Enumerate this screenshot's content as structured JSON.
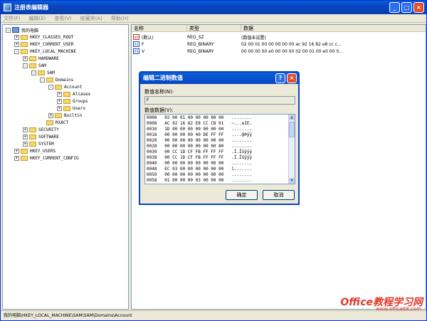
{
  "window": {
    "title": "注册表编辑器",
    "min": "_",
    "max": "□",
    "close": "×"
  },
  "menu": [
    "文件(F)",
    "编辑(E)",
    "查看(V)",
    "收藏夹(A)",
    "帮助(H)"
  ],
  "tree": [
    {
      "label": "我的电脑",
      "indent": 0,
      "exp": "-",
      "icon": "pc"
    },
    {
      "label": "HKEY_CLASSES_ROOT",
      "indent": 1,
      "exp": "+"
    },
    {
      "label": "HKEY_CURRENT_USER",
      "indent": 1,
      "exp": "+"
    },
    {
      "label": "HKEY_LOCAL_MACHINE",
      "indent": 1,
      "exp": "-"
    },
    {
      "label": "HARDWARE",
      "indent": 2,
      "exp": "+"
    },
    {
      "label": "SAM",
      "indent": 2,
      "exp": "-"
    },
    {
      "label": "SAM",
      "indent": 3,
      "exp": "-"
    },
    {
      "label": "Domains",
      "indent": 4,
      "exp": "-"
    },
    {
      "label": "Account",
      "indent": 5,
      "exp": "-"
    },
    {
      "label": "Aliases",
      "indent": 6,
      "exp": "+"
    },
    {
      "label": "Groups",
      "indent": 6,
      "exp": "+"
    },
    {
      "label": "Users",
      "indent": 6,
      "exp": "+"
    },
    {
      "label": "Builtin",
      "indent": 5,
      "exp": "+"
    },
    {
      "label": "RXACT",
      "indent": 4,
      "exp": ""
    },
    {
      "label": "SECURITY",
      "indent": 2,
      "exp": "+"
    },
    {
      "label": "SOFTWARE",
      "indent": 2,
      "exp": "+"
    },
    {
      "label": "SYSTEM",
      "indent": 2,
      "exp": "+"
    },
    {
      "label": "HKEY_USERS",
      "indent": 1,
      "exp": "+"
    },
    {
      "label": "HKEY_CURRENT_CONFIG",
      "indent": 1,
      "exp": "+"
    }
  ],
  "columns": [
    "名称",
    "类型",
    "数据"
  ],
  "values": [
    {
      "icon": "ab",
      "name": "(默认)",
      "type": "REG_SZ",
      "data": "(数值未设置)"
    },
    {
      "icon": "01",
      "name": "F",
      "type": "REG_BINARY",
      "data": "02 00 01 00 00 00 00 00 ac 92 16 82 e8 cc c..."
    },
    {
      "icon": "01",
      "name": "V",
      "type": "REG_BINARY",
      "data": "00 00 00 00 e0 00 00 00 02 00 01 00 e0 00 0..."
    }
  ],
  "status": "我的电脑\\HKEY_LOCAL_MACHINE\\SAM\\SAM\\Domains\\Account",
  "dialog": {
    "title": "编辑二进制数值",
    "help": "?",
    "close": "×",
    "name_label": "数值名称(N):",
    "name_value": "F",
    "data_label": "数值数据(V):",
    "hex": [
      "0000   02 00 01 00 00 00 00 00   ........",
      "0008   AC 92 16 82 E8 CC CB 01   ~...eIE.",
      "0010   1D 00 00 00 00 00 00 00   ........",
      "0018   00 00 00 00 40 DE FF FF   ....@Þÿÿ",
      "0020   00 00 00 00 00 00 00 00   ........",
      "0028   00 00 00 00 00 00 00 80   ........",
      "0030   00 CC 1D CF FB FF FF FF   .Ì.Ïûÿÿÿ",
      "0038   00 CC 1D CF FB FF FF FF   .Ì.Ïûÿÿÿ",
      "0040   00 00 00 00 00 00 00 00   ........",
      "0048   EC 03 00 00 00 00 00 00   ì.......",
      "0050   00 00 00 00 00 00 00 00   ........",
      "0058   01 00 00 00 03 00 00 00   ........"
    ],
    "ok": "确定",
    "cancel": "取消"
  },
  "watermark": {
    "brand": "Office教程学习网",
    "url": "www.office68.com"
  }
}
